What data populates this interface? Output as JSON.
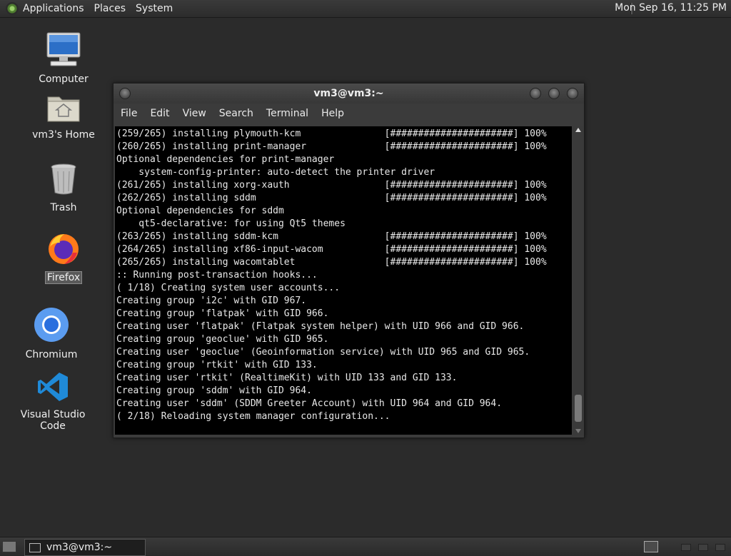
{
  "top_panel": {
    "menus": [
      "Applications",
      "Places",
      "System"
    ],
    "clock": "Mon Sep 16, 11:25 PM"
  },
  "desktop_icons": [
    {
      "label": "Computer",
      "icon": "computer-icon"
    },
    {
      "label": "vm3's Home",
      "icon": "home-folder-icon"
    },
    {
      "label": "Trash",
      "icon": "trash-icon"
    },
    {
      "label": "Firefox",
      "icon": "firefox-icon"
    },
    {
      "label": "Chromium",
      "icon": "chromium-icon"
    },
    {
      "label": "Visual Studio Code",
      "icon": "vscode-icon"
    }
  ],
  "terminal": {
    "title": "vm3@vm3:~",
    "menu": [
      "File",
      "Edit",
      "View",
      "Search",
      "Terminal",
      "Help"
    ],
    "lines": [
      "(259/265) installing plymouth-kcm               [######################] 100%",
      "(260/265) installing print-manager              [######################] 100%",
      "Optional dependencies for print-manager",
      "    system-config-printer: auto-detect the printer driver",
      "(261/265) installing xorg-xauth                 [######################] 100%",
      "(262/265) installing sddm                       [######################] 100%",
      "Optional dependencies for sddm",
      "    qt5-declarative: for using Qt5 themes",
      "(263/265) installing sddm-kcm                   [######################] 100%",
      "(264/265) installing xf86-input-wacom           [######################] 100%",
      "(265/265) installing wacomtablet                [######################] 100%",
      ":: Running post-transaction hooks...",
      "( 1/18) Creating system user accounts...",
      "Creating group 'i2c' with GID 967.",
      "Creating group 'flatpak' with GID 966.",
      "Creating user 'flatpak' (Flatpak system helper) with UID 966 and GID 966.",
      "Creating group 'geoclue' with GID 965.",
      "Creating user 'geoclue' (Geoinformation service) with UID 965 and GID 965.",
      "Creating group 'rtkit' with GID 133.",
      "Creating user 'rtkit' (RealtimeKit) with UID 133 and GID 133.",
      "Creating group 'sddm' with GID 964.",
      "Creating user 'sddm' (SDDM Greeter Account) with UID 964 and GID 964.",
      "( 2/18) Reloading system manager configuration..."
    ]
  },
  "taskbar": {
    "window_label": "vm3@vm3:~"
  }
}
